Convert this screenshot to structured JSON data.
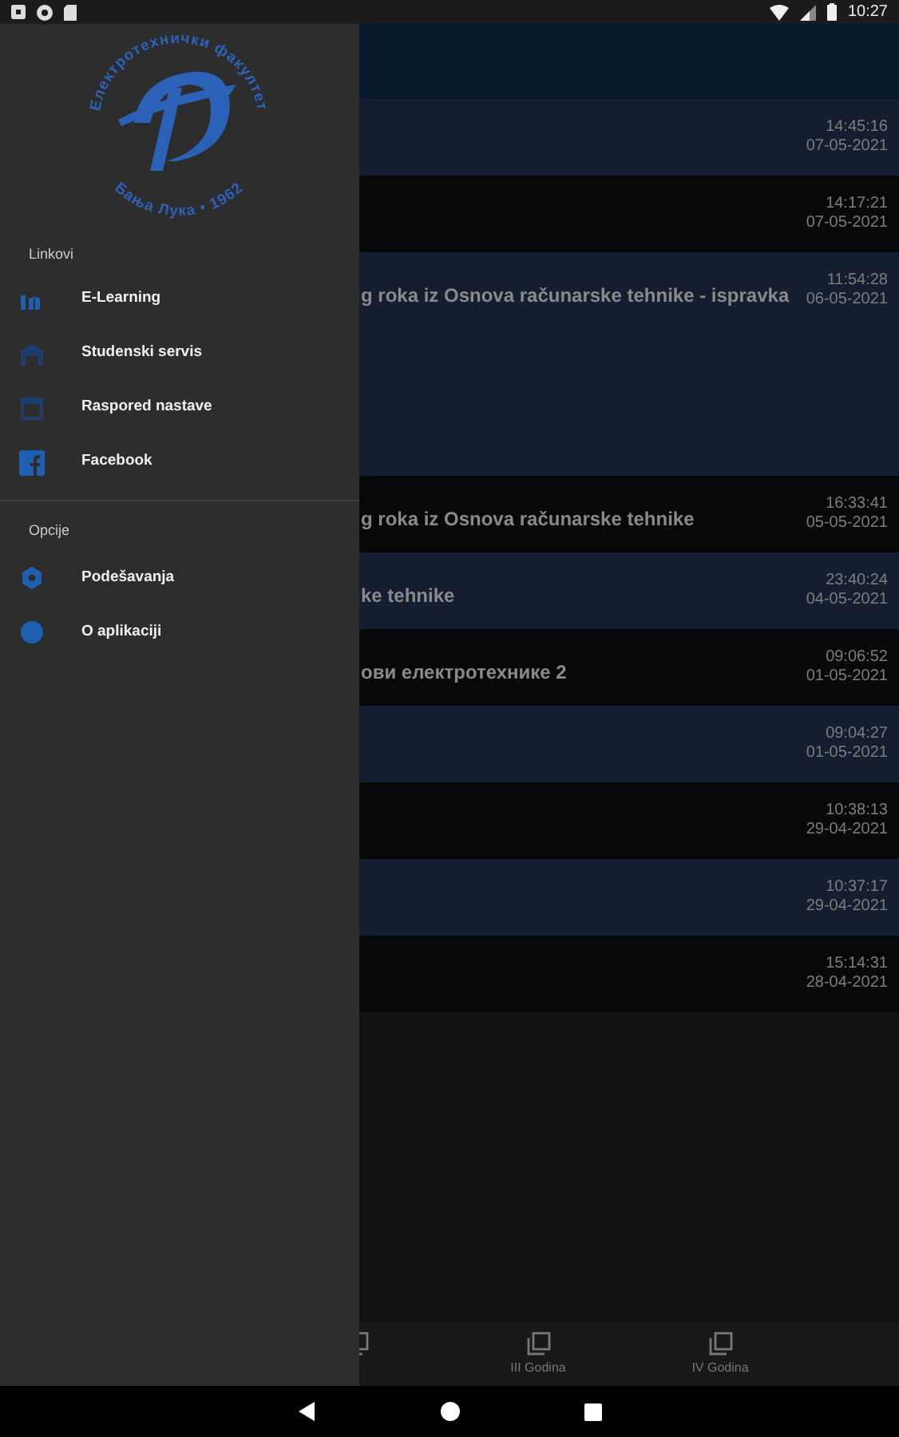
{
  "status_bar": {
    "time": "10:27"
  },
  "feed": [
    {
      "time": "14:45:16",
      "date": "07-05-2021",
      "shaded": true,
      "kind": "compact"
    },
    {
      "time": "14:17:21",
      "date": "07-05-2021",
      "shaded": false,
      "kind": "compact"
    },
    {
      "title": "g roka iz Osnova računarske tehnike - ispravka",
      "time": "11:54:28",
      "date": "06-05-2021",
      "shaded": true,
      "kind": "expanded"
    },
    {
      "title": "g roka iz Osnova računarske tehnike",
      "time": "16:33:41",
      "date": "05-05-2021",
      "shaded": false,
      "kind": "compact"
    },
    {
      "title": "ke tehnike",
      "time": "23:40:24",
      "date": "04-05-2021",
      "shaded": true,
      "kind": "compact"
    },
    {
      "title": "ови електротехнике 2",
      "time": "09:06:52",
      "date": "01-05-2021",
      "shaded": false,
      "kind": "compact"
    },
    {
      "time": "09:04:27",
      "date": "01-05-2021",
      "shaded": true,
      "kind": "compact"
    },
    {
      "time": "10:38:13",
      "date": "29-04-2021",
      "shaded": false,
      "kind": "compact"
    },
    {
      "time": "10:37:17",
      "date": "29-04-2021",
      "shaded": true,
      "kind": "compact"
    },
    {
      "time": "15:14:31",
      "date": "28-04-2021",
      "shaded": false,
      "kind": "compact"
    }
  ],
  "bottom_nav": [
    {
      "label": "III Godina"
    },
    {
      "label": "IV Godina"
    }
  ],
  "drawer": {
    "logo": {
      "top_text": "Електротехнички факултет",
      "bottom_text": "Бања Лука • 1962"
    },
    "sections": [
      {
        "header": "Linkovi",
        "items": [
          {
            "label": "E-Learning",
            "kind": "elearning"
          },
          {
            "label": "Studenski servis",
            "kind": "building"
          },
          {
            "label": "Raspored nastave",
            "kind": "calendar"
          },
          {
            "label": "Facebook",
            "kind": "facebook"
          }
        ]
      },
      {
        "header": "Opcije",
        "items": [
          {
            "label": "Podešavanja",
            "kind": "gear"
          },
          {
            "label": "O aplikaciji",
            "kind": "info"
          }
        ]
      }
    ]
  }
}
